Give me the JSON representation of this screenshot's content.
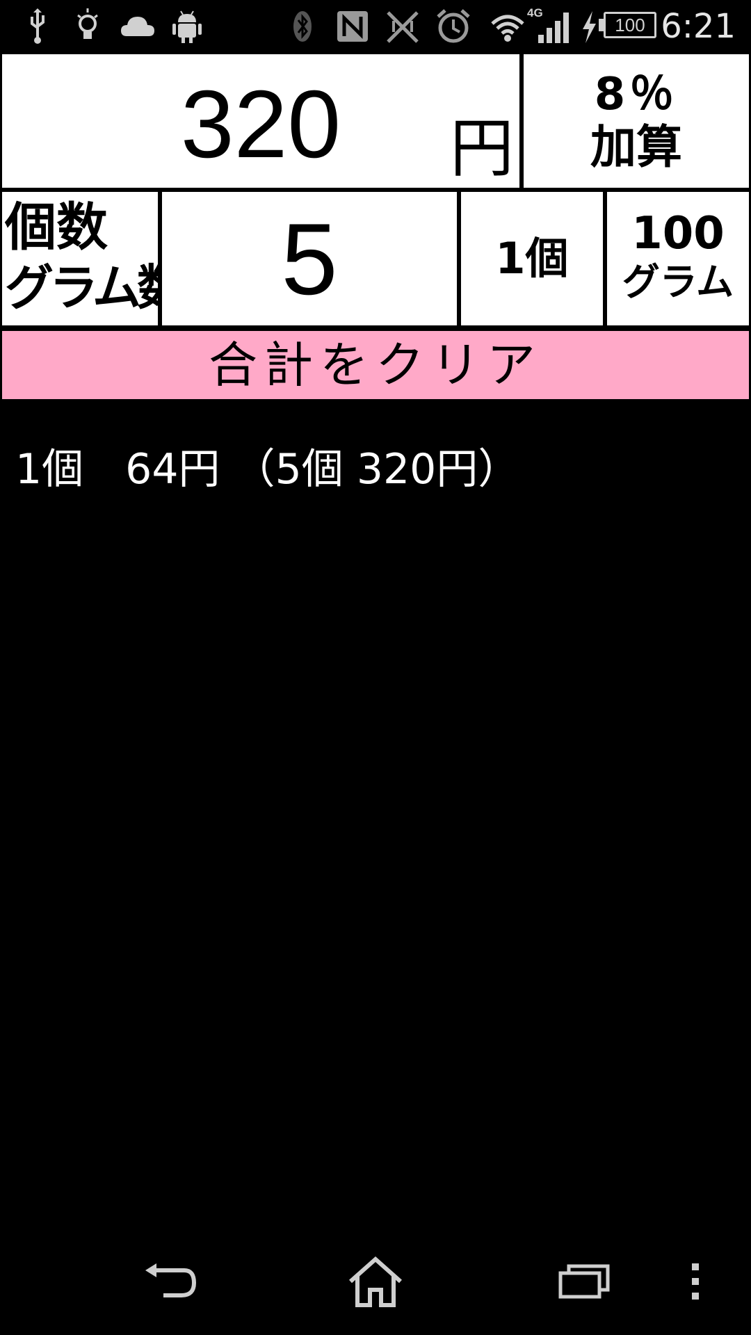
{
  "status_bar": {
    "time": "6:21",
    "battery_level": "100",
    "network_type": "4G",
    "icons": [
      "usb-icon",
      "lightbulb-icon",
      "cloud-icon",
      "android-icon",
      "bluetooth-icon",
      "nfc-icon",
      "mute-icon",
      "alarm-icon",
      "wifi-icon",
      "signal-icon",
      "charging-icon",
      "battery-icon"
    ]
  },
  "calculator": {
    "total": "320",
    "total_unit": "円",
    "tax_button": {
      "line1": "8％",
      "line2": "加算"
    },
    "quantity_label": {
      "line1": "個数",
      "line2": "グラム数"
    },
    "quantity_value": "5",
    "unit_one_button": "1個",
    "unit_gram_button": {
      "line1": "100",
      "line2": "グラム"
    },
    "clear_button": "合計をクリア",
    "result": "1個　64円 （5個 320円）"
  },
  "nav_bar": {
    "buttons": [
      "back-icon",
      "home-icon",
      "recent-apps-icon",
      "overflow-menu-icon"
    ]
  },
  "colors": {
    "clear_button_bg": "#ffa9c8",
    "panel_bg": "#ffffff",
    "screen_bg": "#000000"
  }
}
